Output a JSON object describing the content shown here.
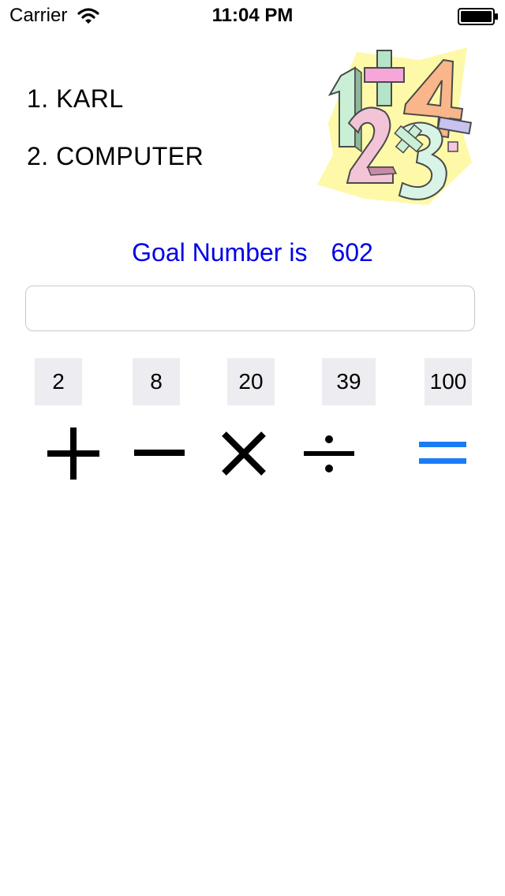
{
  "status_bar": {
    "carrier": "Carrier",
    "time": "11:04 PM"
  },
  "players": [
    {
      "label": "1. KARL"
    },
    {
      "label": "2. COMPUTER"
    }
  ],
  "goal": {
    "label": "Goal Number is",
    "value": "602"
  },
  "answer_field": {
    "value": "",
    "placeholder": ""
  },
  "numbers": [
    "2",
    "8",
    "20",
    "39",
    "100"
  ],
  "operators": [
    {
      "name": "plus-icon"
    },
    {
      "name": "minus-icon"
    },
    {
      "name": "multiply-icon"
    },
    {
      "name": "divide-icon"
    },
    {
      "name": "equals-icon"
    }
  ],
  "colors": {
    "goal_text": "#0000e6",
    "equals": "#1a7cf5",
    "operator": "#000000",
    "tile_bg": "#ededf1"
  }
}
